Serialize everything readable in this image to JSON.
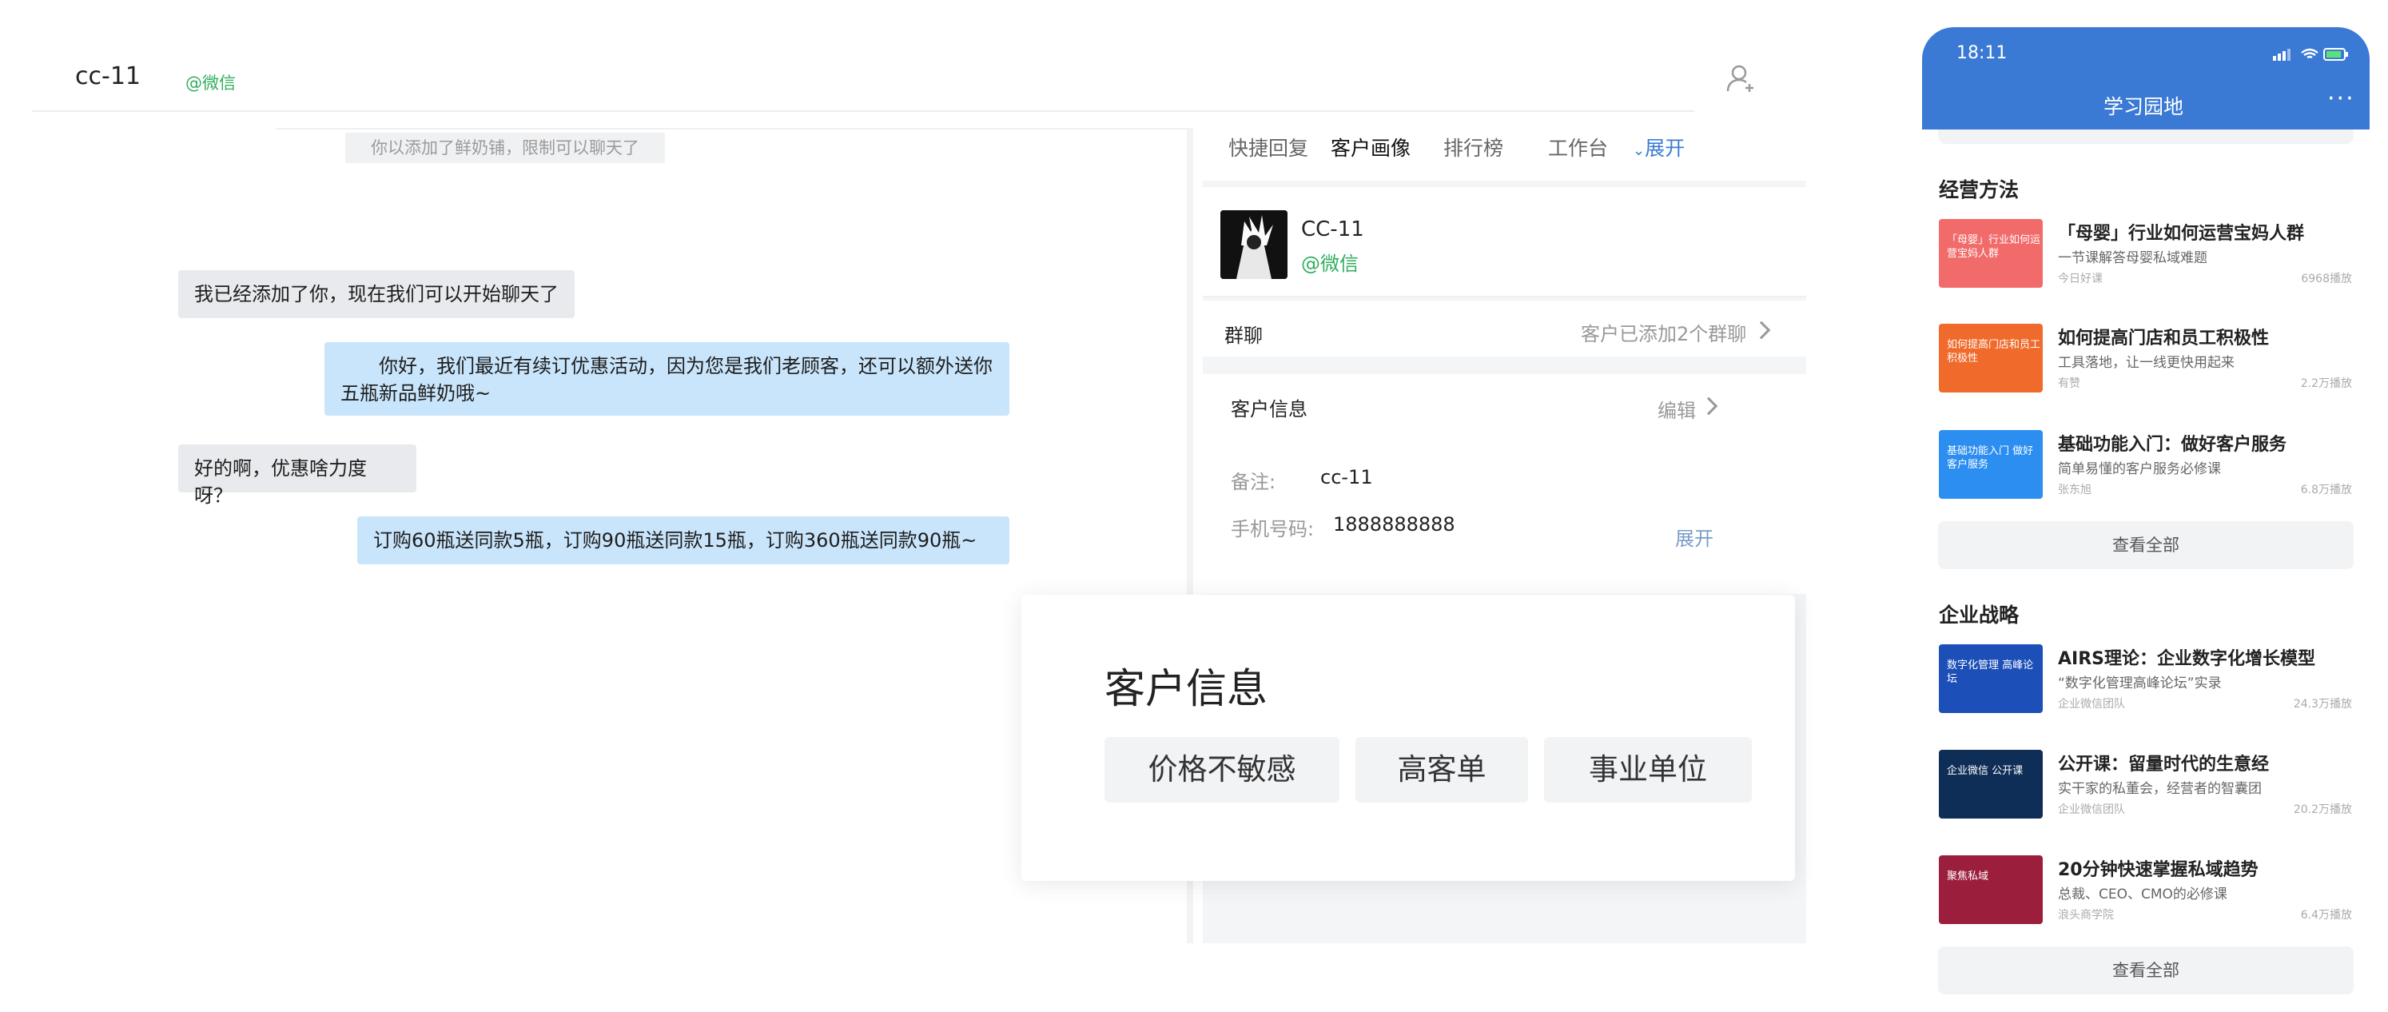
{
  "chat": {
    "contact_name": "cc-11",
    "contact_source": "@微信",
    "system_message": "你以添加了鲜奶铺，限制可以聊天了",
    "messages": [
      {
        "side": "recv",
        "text": "我已经添加了你，现在我们可以开始聊天了"
      },
      {
        "side": "sent",
        "text": "你好，我们最近有续订优惠活动，因为您是我们老顾客，还可以额外送你五瓶新品鲜奶哦~"
      },
      {
        "side": "recv",
        "text": "好的啊，优惠啥力度呀？"
      },
      {
        "side": "sent",
        "text": "订购60瓶送同款5瓶，订购90瓶送同款15瓶，订购360瓶送同款90瓶~"
      }
    ]
  },
  "panel": {
    "tabs": [
      "快捷回复",
      "客户画像",
      "排行榜",
      "工作台"
    ],
    "active_tab": 1,
    "expand_label": "展开",
    "profile": {
      "name": "CC-11",
      "source": "@微信"
    },
    "group_chat": {
      "label": "群聊",
      "value": "客户已添加2个群聊"
    },
    "customer_info": {
      "title": "客户信息",
      "edit_label": "编辑",
      "remark_label": "备注:",
      "remark_value": "cc-11",
      "phone_label": "手机号码:",
      "phone_value": "1888888888",
      "more_label": "展开"
    }
  },
  "tag_card": {
    "title": "客户信息",
    "tags": [
      "价格不敏感",
      "高客单",
      "事业单位"
    ]
  },
  "phone": {
    "time": "18:11",
    "title": "学习园地",
    "more_label": "···",
    "sections": [
      {
        "title": "经营方法",
        "items": [
          {
            "title": "「母婴」行业如何运营宝妈人群",
            "subtitle": "一节课解答母婴私域难题",
            "author": "今日好课",
            "plays": "6968播放",
            "thumb_text": "「母婴」行业如何运营宝妈人群",
            "color": "#f26b6b"
          },
          {
            "title": "如何提高门店和员工积极性",
            "subtitle": "工具落地，让一线更快用起来",
            "author": "有赞",
            "plays": "2.2万播放",
            "thumb_text": "如何提高门店和员工积极性",
            "color": "#f06a2b"
          },
          {
            "title": "基础功能入门：做好客户服务",
            "subtitle": "简单易懂的客户服务必修课",
            "author": "张东旭",
            "plays": "6.8万播放",
            "thumb_text": "基础功能入门 做好客户服务",
            "color": "#2c8ef0"
          }
        ],
        "view_all": "查看全部"
      },
      {
        "title": "企业战略",
        "items": [
          {
            "title": "AIRS理论：企业数字化增长模型",
            "subtitle": "“数字化管理高峰论坛”实录",
            "author": "企业微信团队",
            "plays": "24.3万播放",
            "thumb_text": "数字化管理 高峰论坛",
            "color": "#1d4fb8"
          },
          {
            "title": "公开课：留量时代的生意经",
            "subtitle": "实干家的私董会，经营者的智囊团",
            "author": "企业微信团队",
            "plays": "20.2万播放",
            "thumb_text": "企业微信 公开课",
            "color": "#0f2e57"
          },
          {
            "title": "20分钟快速掌握私域趋势",
            "subtitle": "总裁、CEO、CMO的必修课",
            "author": "浪头商学院",
            "plays": "6.4万播放",
            "thumb_text": "聚焦私域",
            "color": "#9b1f3c"
          }
        ],
        "view_all": "查看全部"
      }
    ]
  }
}
